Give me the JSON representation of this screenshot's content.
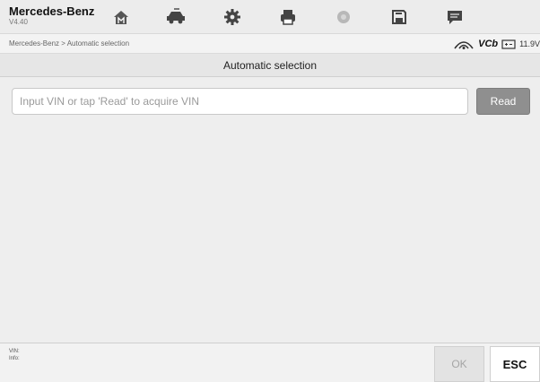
{
  "header": {
    "app_title": "Mercedes-Benz",
    "version": "V4.40",
    "toolbar": [
      {
        "icon": "home-icon"
      },
      {
        "icon": "vehicle-swap-icon"
      },
      {
        "icon": "settings-gear-icon"
      },
      {
        "icon": "print-icon"
      },
      {
        "icon": "help-icon"
      },
      {
        "icon": "save-icon"
      },
      {
        "icon": "data-logging-icon"
      }
    ]
  },
  "breadcrumb": {
    "text": "Mercedes-Benz > Automatic selection"
  },
  "status": {
    "vci_label": "VCb",
    "battery_voltage": "11.9V"
  },
  "page": {
    "title": "Automatic selection"
  },
  "vin_form": {
    "input_value": "",
    "placeholder": "Input VIN or tap 'Read' to acquire VIN",
    "read_label": "Read"
  },
  "footer": {
    "vin_label": "VIN:",
    "info_label": "Info:",
    "ok_label": "OK",
    "esc_label": "ESC"
  }
}
